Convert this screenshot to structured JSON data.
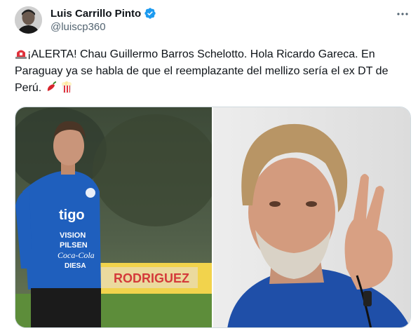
{
  "author": {
    "display_name": "Luis Carrillo Pinto",
    "handle": "@luiscp360",
    "verified": true
  },
  "tweet": {
    "text": "¡ALERTA! Chau Guillermo Barros Schelotto. Hola Ricardo Gareca. En Paraguay ya se habla de que el reemplazante del mellizo sería el ex DT de Perú.",
    "emojis": [
      "rotating-light-icon",
      "hot-pepper-icon",
      "popcorn-icon"
    ]
  },
  "media": {
    "left_photo": {
      "shirt_text": [
        "tigo",
        "VISION",
        "PILSEN",
        "Coca-Cola",
        "DIESA"
      ],
      "banner_text": "RODRIGUEZ"
    }
  },
  "colors": {
    "verified": "#1d9bf0",
    "text": "#0f1419",
    "secondary": "#536471",
    "shirt_blue": "#1f5fbd"
  }
}
